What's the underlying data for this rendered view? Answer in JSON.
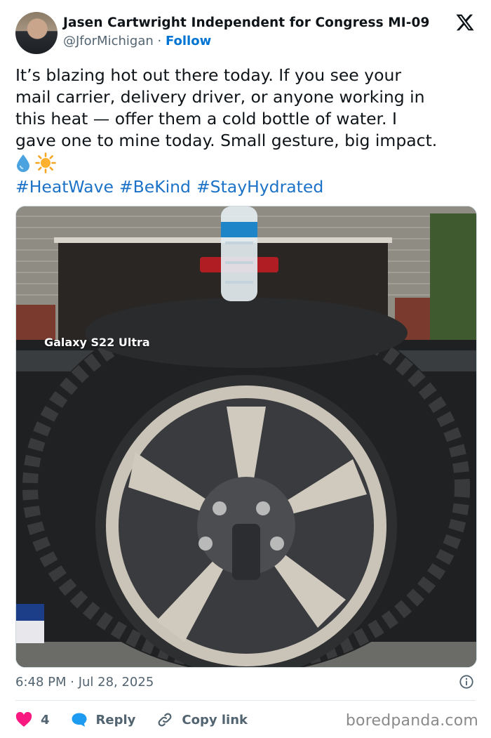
{
  "author": {
    "name": "Jasen Cartwright Independent for Congress MI-09",
    "handle": "@JforMichigan",
    "separator": " · ",
    "follow_label": "Follow"
  },
  "tweet": {
    "lines": [
      "It’s blazing hot out there today. If you see your",
      "mail carrier, delivery driver, or anyone working in",
      "this heat — offer them a cold bottle of water. I",
      "gave one to mine today. Small gesture, big impact."
    ],
    "emojis": [
      "💧",
      "☀️"
    ],
    "hashtags": [
      "#HeatWave",
      "#BeKind",
      "#StayHydrated"
    ]
  },
  "media": {
    "camera_watermark": "Galaxy S22 Ultra",
    "icons": [
      "water-bottle",
      "tire",
      "wheel"
    ]
  },
  "timestamp": "6:48 PM · Jul 28, 2025",
  "actions": {
    "like_count": "4",
    "reply_label": "Reply",
    "copy_label": "Copy link"
  },
  "brand": "boredpanda.com",
  "colors": {
    "link": "#1b72c7",
    "follow": "#0074d3",
    "heart": "#f91880",
    "reply_bubble": "#1d9bf0"
  }
}
